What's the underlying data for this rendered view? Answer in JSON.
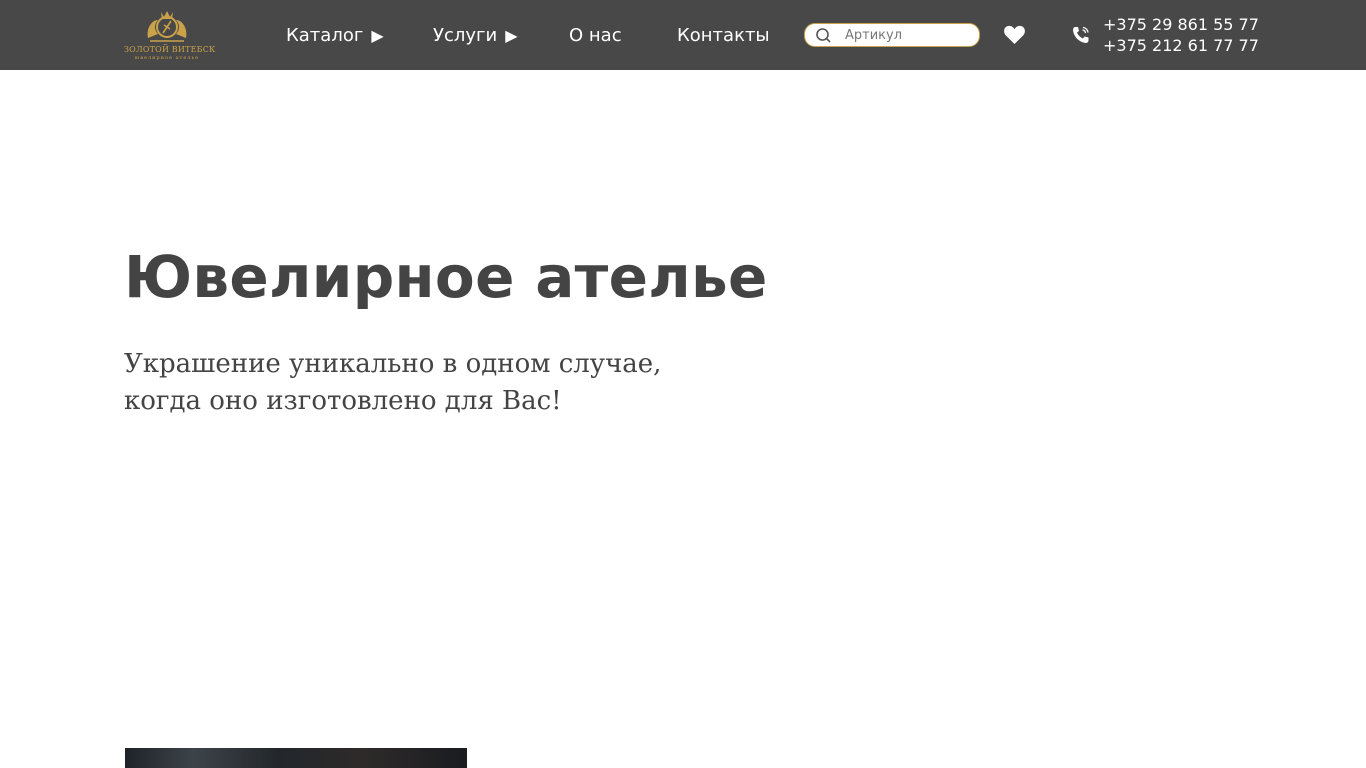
{
  "header": {
    "logo": {
      "line1": "ЗОЛОТОЙ ВИТЕБСК",
      "line2": "ювелирное ателье",
      "color": "#c9a24a"
    },
    "nav": [
      {
        "label": "Каталог",
        "has_submenu": true,
        "arrow": "▶"
      },
      {
        "label": "Услуги",
        "has_submenu": true,
        "arrow": "▶"
      },
      {
        "label": "О нас",
        "has_submenu": false
      },
      {
        "label": "Контакты",
        "has_submenu": false
      }
    ],
    "search": {
      "placeholder": "Артикул",
      "value": "",
      "icon": "search-icon"
    },
    "favorites_icon": "heart-icon",
    "phone_icon": "phone-icon",
    "phones": [
      "+375 29 861 55 77",
      "+375 212 61 77 77"
    ],
    "background": "#484848"
  },
  "hero": {
    "title": "Ювелирное ателье",
    "subtitle_line1": "Украшение уникально в одном случае,",
    "subtitle_line2": "когда оно изготовлено для Вас!"
  }
}
